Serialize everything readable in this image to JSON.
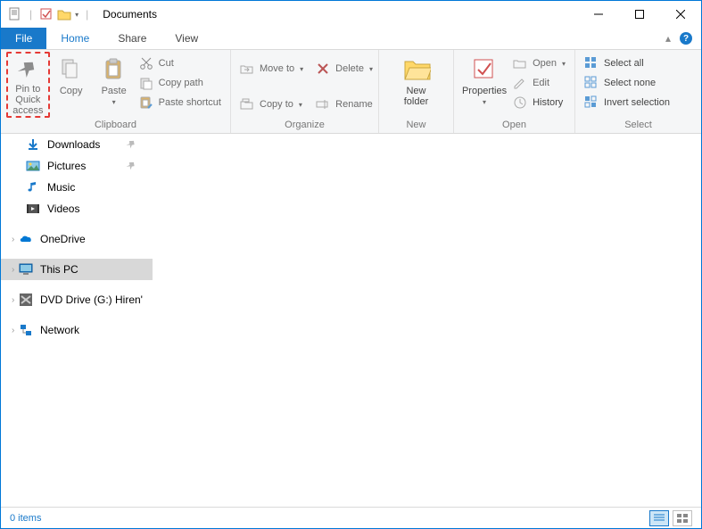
{
  "window": {
    "title": "Documents"
  },
  "tabs": {
    "file": "File",
    "home": "Home",
    "share": "Share",
    "view": "View"
  },
  "ribbon": {
    "pin_quick": "Pin to Quick\naccess",
    "copy": "Copy",
    "paste": "Paste",
    "cut": "Cut",
    "copy_path": "Copy path",
    "paste_shortcut": "Paste shortcut",
    "move_to": "Move to",
    "copy_to": "Copy to",
    "delete": "Delete",
    "rename": "Rename",
    "new_folder": "New\nfolder",
    "properties": "Properties",
    "open": "Open",
    "edit": "Edit",
    "history": "History",
    "select_all": "Select all",
    "select_none": "Select none",
    "invert_selection": "Invert selection",
    "group_clipboard": "Clipboard",
    "group_organize": "Organize",
    "group_new": "New",
    "group_open": "Open",
    "group_select": "Select"
  },
  "nav": {
    "downloads": "Downloads",
    "pictures": "Pictures",
    "music": "Music",
    "videos": "Videos",
    "onedrive": "OneDrive",
    "this_pc": "This PC",
    "dvd": "DVD Drive (G:) Hiren'",
    "network": "Network"
  },
  "status": {
    "count": "0 items"
  }
}
